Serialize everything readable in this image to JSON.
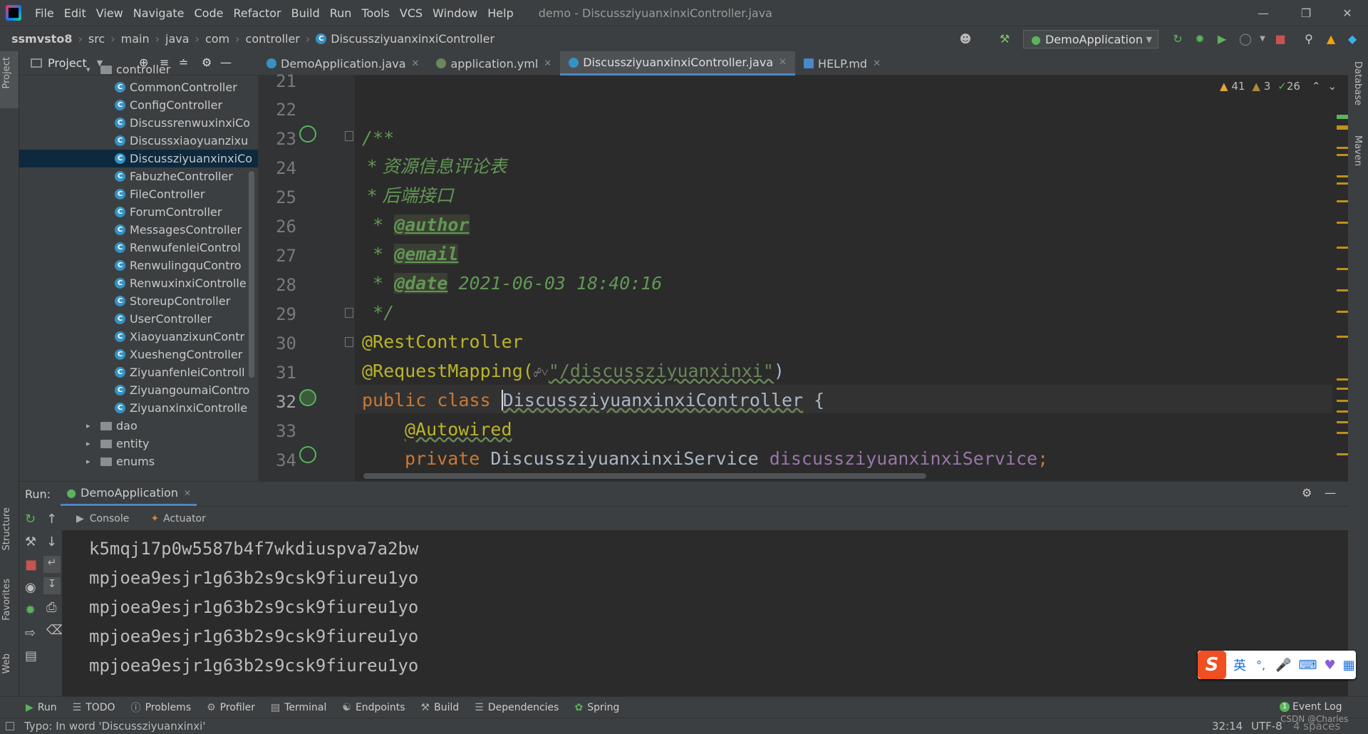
{
  "menu": [
    "File",
    "Edit",
    "View",
    "Navigate",
    "Code",
    "Refactor",
    "Build",
    "Run",
    "Tools",
    "VCS",
    "Window",
    "Help"
  ],
  "window_title": "demo - DiscussziyuanxinxiController.java",
  "breadcrumb": [
    "ssmvsto8",
    "src",
    "main",
    "java",
    "com",
    "controller",
    "DiscussziyuanxinxiController"
  ],
  "run_config": "DemoApplication",
  "project_panel": {
    "title": "Project",
    "tree": [
      {
        "label": "controller",
        "kind": "folder",
        "expanded": true
      },
      {
        "label": "CommonController",
        "kind": "class"
      },
      {
        "label": "ConfigController",
        "kind": "class"
      },
      {
        "label": "DiscussrenwuxinxiCo",
        "kind": "class"
      },
      {
        "label": "Discussxiaoyuanzixu",
        "kind": "class"
      },
      {
        "label": "DiscussziyuanxinxiCo",
        "kind": "class",
        "selected": true
      },
      {
        "label": "FabuzheController",
        "kind": "class"
      },
      {
        "label": "FileController",
        "kind": "class"
      },
      {
        "label": "ForumController",
        "kind": "class"
      },
      {
        "label": "MessagesController",
        "kind": "class"
      },
      {
        "label": "RenwufenleiControl",
        "kind": "class"
      },
      {
        "label": "RenwulingquContro",
        "kind": "class"
      },
      {
        "label": "RenwuxinxiControlle",
        "kind": "class"
      },
      {
        "label": "StoreupController",
        "kind": "class"
      },
      {
        "label": "UserController",
        "kind": "class"
      },
      {
        "label": "XiaoyuanzixunContr",
        "kind": "class"
      },
      {
        "label": "XueshengController",
        "kind": "class"
      },
      {
        "label": "ZiyuanfenleiControll",
        "kind": "class"
      },
      {
        "label": "ZiyuangoumaiContro",
        "kind": "class"
      },
      {
        "label": "ZiyuanxinxiControlle",
        "kind": "class"
      },
      {
        "label": "dao",
        "kind": "folder",
        "expanded": false
      },
      {
        "label": "entity",
        "kind": "folder",
        "expanded": false
      },
      {
        "label": "enums",
        "kind": "folder",
        "expanded": false
      }
    ]
  },
  "tabs": [
    {
      "label": "DemoApplication.java",
      "active": false
    },
    {
      "label": "application.yml",
      "active": false
    },
    {
      "label": "DiscussziyuanxinxiController.java",
      "active": true
    },
    {
      "label": "HELP.md",
      "active": false
    }
  ],
  "inspections": {
    "warnings": "41",
    "weak_warnings": "3",
    "ok": "26"
  },
  "editor": {
    "line_numbers": [
      "21",
      "22",
      "23",
      "24",
      "25",
      "26",
      "27",
      "28",
      "29",
      "30",
      "31",
      "32",
      "33",
      "34"
    ],
    "doc_open": "/**",
    "doc_line1": " * 资源信息评论表",
    "doc_line2": " * 后端接口",
    "doc_star": " * ",
    "tag_author": "@author",
    "tag_email": "@email",
    "tag_date": "@date",
    "date_value": " 2021-06-03 18:40:16",
    "doc_close": " */",
    "ann_rest": "@RestController",
    "ann_mapping": "@RequestMapping(",
    "mapping_path": "\"/discussziyuanxinxi\"",
    "mapping_close": ")",
    "kw_public_class": "public class ",
    "class_name": "DiscussziyuanxinxiController",
    "brace": " {",
    "ann_autowired": "@Autowired",
    "kw_private": "private ",
    "service_type": "DiscussziyuanxinxiService ",
    "service_field": "discussziyuanxinxiService",
    "semicolon": ";"
  },
  "run_panel": {
    "label": "Run:",
    "config_tab": "DemoApplication",
    "subtabs": [
      "Console",
      "Actuator"
    ],
    "console_lines": [
      "k5mqj17p0w5587b4f7wkdiuspva7a2bw",
      "mpjoea9esjr1g63b2s9csk9fiureu1yo",
      "mpjoea9esjr1g63b2s9csk9fiureu1yo",
      "mpjoea9esjr1g63b2s9csk9fiureu1yo",
      "mpjoea9esjr1g63b2s9csk9fiureu1yo"
    ]
  },
  "bottom_tools": [
    "Run",
    "TODO",
    "Problems",
    "Profiler",
    "Terminal",
    "Endpoints",
    "Build",
    "Dependencies",
    "Spring"
  ],
  "event_log": "Event Log",
  "event_log_count": "1",
  "left_strip": [
    "Project",
    "Structure",
    "Favorites",
    "Web"
  ],
  "right_strip": [
    "Database",
    "Maven"
  ],
  "status": {
    "message": "Typo: In word 'Discussziyuanxinxi'",
    "position": "32:14",
    "encoding": "UTF-8",
    "indent": "4 spaces",
    "watermark": "CSDN @Charles"
  },
  "ime": {
    "logo": "S",
    "mode": "英",
    "punct": "°,"
  },
  "colors": {
    "accent": "#4a88c7",
    "selection": "#0d293e",
    "doc": "#629755",
    "keyword": "#cc7832",
    "annotation": "#bbb529",
    "field": "#9876aa"
  }
}
